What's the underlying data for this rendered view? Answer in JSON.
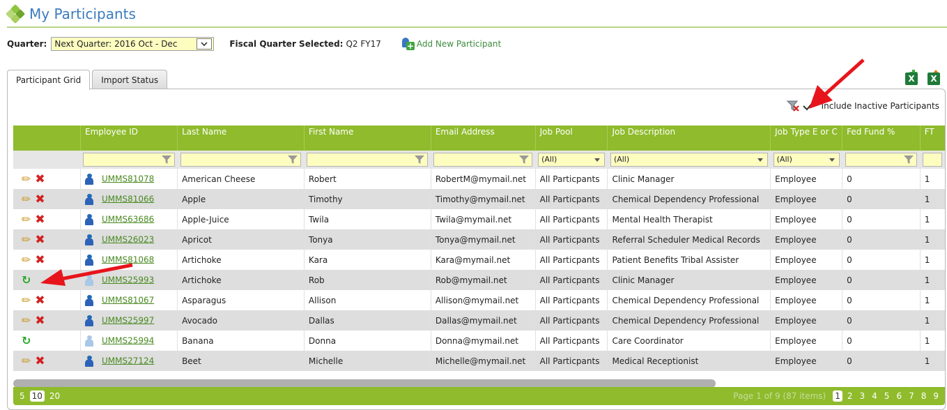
{
  "page": {
    "title": "My Participants"
  },
  "quarter": {
    "label": "Quarter:",
    "value": "Next Quarter: 2016 Oct - Dec",
    "fiscal_label": "Fiscal Quarter Selected:",
    "fiscal_value": "Q2 FY17"
  },
  "add_participant_label": "Add New Participant",
  "tabs": [
    {
      "label": "Participant Grid",
      "active": true
    },
    {
      "label": "Import Status",
      "active": false
    }
  ],
  "include_inactive_label": "Include Inactive Participants",
  "grid": {
    "columns": [
      "",
      "Employee ID",
      "Last Name",
      "First Name",
      "Email Address",
      "Job Pool",
      "Job Description",
      "Job Type E or C",
      "Fed Fund %",
      "FT"
    ],
    "filter_all": "(All)",
    "rows": [
      {
        "active": true,
        "id": "UMMS81078",
        "last": "American Cheese",
        "first": "Robert",
        "email": "RobertM@mymail.net",
        "pool": "All Particpants",
        "desc": "Clinic Manager",
        "type": "Employee",
        "fed": "0",
        "ft": "1"
      },
      {
        "active": true,
        "id": "UMMS81066",
        "last": "Apple",
        "first": "Timothy",
        "email": "Timothy@mymail.net",
        "pool": "All Particpants",
        "desc": "Chemical Dependency Professional",
        "type": "Employee",
        "fed": "0",
        "ft": "1"
      },
      {
        "active": true,
        "id": "UMMS63686",
        "last": "Apple-Juice",
        "first": "Twila",
        "email": "Twila@mymail.net",
        "pool": "All Particpants",
        "desc": "Mental Health Therapist",
        "type": "Employee",
        "fed": "0",
        "ft": "1"
      },
      {
        "active": true,
        "id": "UMMS26023",
        "last": "Apricot",
        "first": "Tonya",
        "email": "Tonya@mymail.net",
        "pool": "All Particpants",
        "desc": "Referral Scheduler Medical Records",
        "type": "Employee",
        "fed": "0",
        "ft": "1"
      },
      {
        "active": true,
        "id": "UMMS81068",
        "last": "Artichoke",
        "first": "Kara",
        "email": "Kara@mymail.net",
        "pool": "All Particpants",
        "desc": "Patient Benefits Tribal Assister",
        "type": "Employee",
        "fed": "0",
        "ft": "1"
      },
      {
        "active": false,
        "id": "UMMS25993",
        "last": "Artichoke",
        "first": "Rob",
        "email": "Rob@mymail.net",
        "pool": "All Particpants",
        "desc": "Clinic Manager",
        "type": "Employee",
        "fed": "0",
        "ft": "1"
      },
      {
        "active": true,
        "id": "UMMS81067",
        "last": "Asparagus",
        "first": "Allison",
        "email": "Allison@mymail.net",
        "pool": "All Particpants",
        "desc": "Chemical Dependency Professional",
        "type": "Employee",
        "fed": "0",
        "ft": "1"
      },
      {
        "active": true,
        "id": "UMMS25997",
        "last": "Avocado",
        "first": "Dallas",
        "email": "Dallas@mymail.net",
        "pool": "All Particpants",
        "desc": "Chemical Dependency Professional",
        "type": "Employee",
        "fed": "0",
        "ft": "1"
      },
      {
        "active": false,
        "id": "UMMS25994",
        "last": "Banana",
        "first": "Donna",
        "email": "Donna@mymail.net",
        "pool": "All Particpants",
        "desc": "Care Coordinator",
        "type": "Employee",
        "fed": "0",
        "ft": "1"
      },
      {
        "active": true,
        "id": "UMMS27124",
        "last": "Beet",
        "first": "Michelle",
        "email": "Michelle@mymail.net",
        "pool": "All Particpants",
        "desc": "Medical Receptionist",
        "type": "Employee",
        "fed": "0",
        "ft": "1"
      }
    ]
  },
  "pager": {
    "sizes": [
      "5",
      "10",
      "20"
    ],
    "selected_size": "10",
    "info": "Page 1 of 9 (87 items)",
    "pages": [
      "1",
      "2",
      "3",
      "4",
      "5",
      "6",
      "7",
      "8",
      "9"
    ],
    "current_page": "1"
  },
  "colors": {
    "accent": "#8fbb2c",
    "title": "#3c7bbd",
    "link": "#4a8a22",
    "filter_bg": "#fdfdc0",
    "annotation_arrow": "#e8141b"
  }
}
